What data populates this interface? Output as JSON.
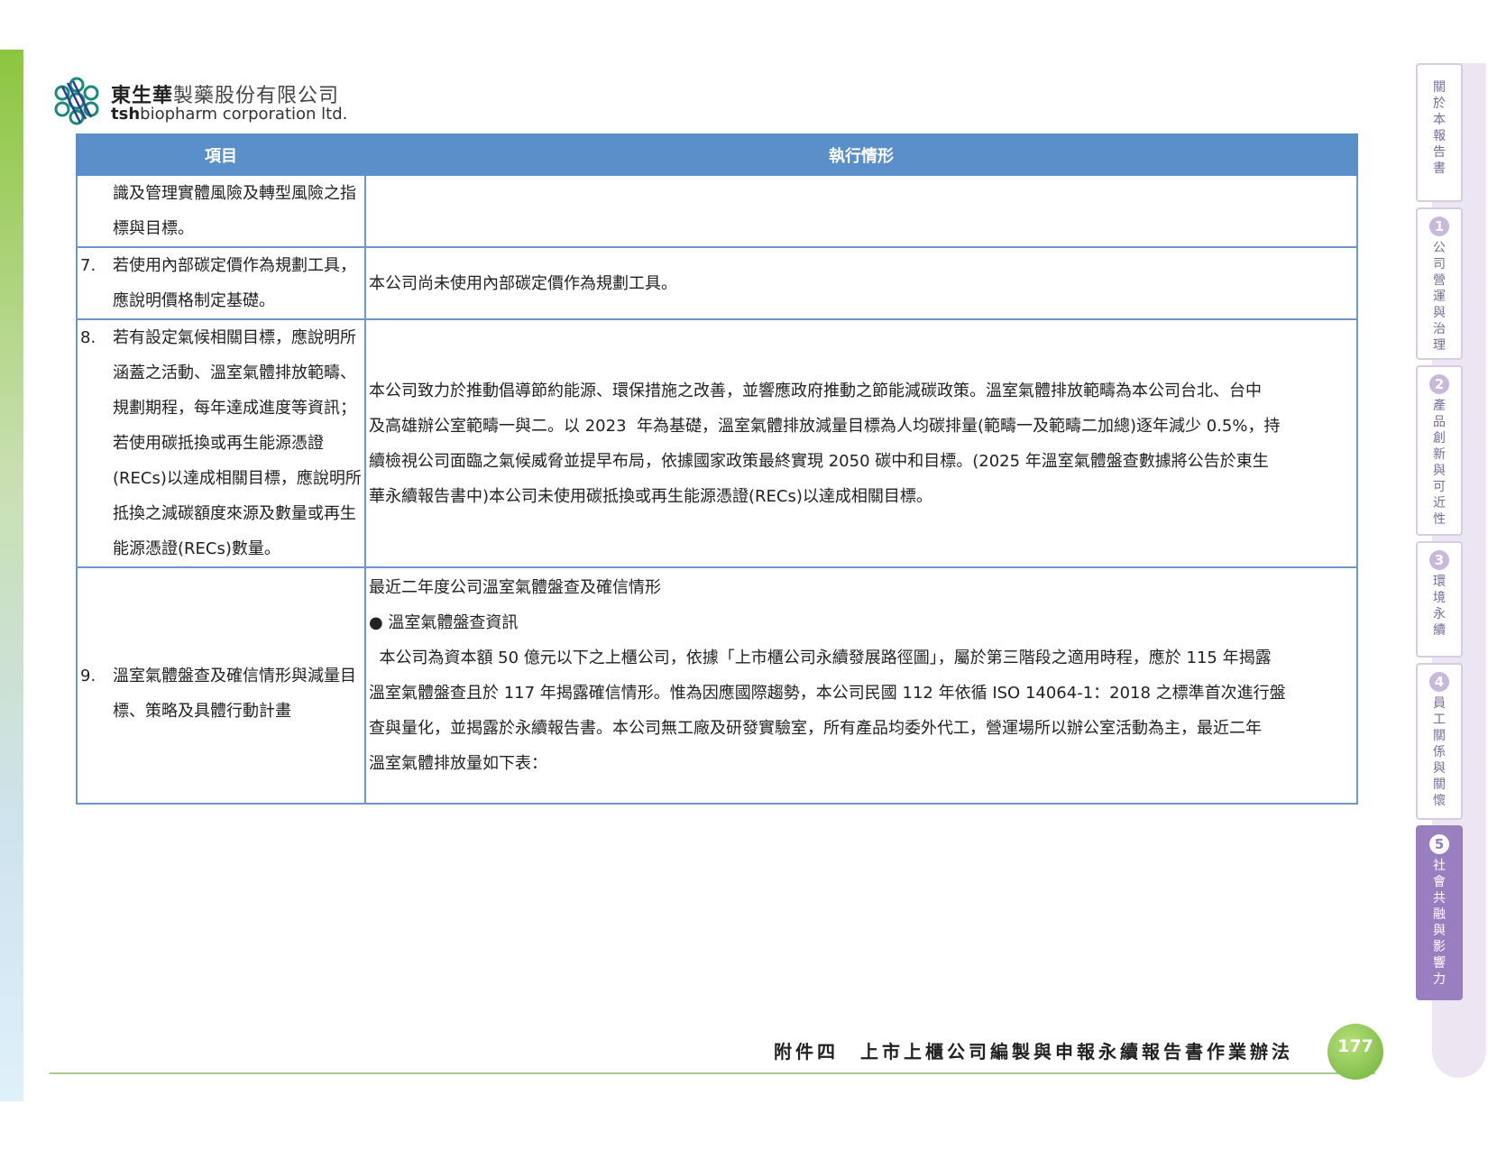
{
  "company": {
    "name_bold": "東生華",
    "name_rest": "製藥股份有限公司",
    "en_bold": "tsh",
    "en_rest": "biopharm corporation ltd."
  },
  "table": {
    "headers": [
      "項目",
      "執行情形"
    ],
    "rows": [
      {
        "num": "",
        "item_lines": [
          "識及管理實體風險及轉型風險之指",
          "標與目標。"
        ],
        "exec_lines": []
      },
      {
        "num": "7.",
        "item_lines": [
          "若使用內部碳定價作為規劃工具，",
          "應說明價格制定基礎。"
        ],
        "exec_lines": [
          "本公司尚未使用內部碳定價作為規劃工具。"
        ]
      },
      {
        "num": "8.",
        "item_lines": [
          "若有設定氣候相關目標，應說明所",
          "涵蓋之活動、溫室氣體排放範疇、",
          "規劃期程，每年達成進度等資訊；",
          "若使用碳抵換或再生能源憑證",
          "(RECs)以達成相關目標，應說明所",
          "抵換之減碳額度來源及數量或再生",
          "能源憑證(RECs)數量。"
        ],
        "exec_lines": [
          "本公司致力於推動倡導節約能源、環保措施之改善，並響應政府推動之節能減碳政策。溫室氣體排放範疇為本公司台北、台中",
          "及高雄辦公室範疇一與二。以 2023  年為基礎，溫室氣體排放減量目標為人均碳排量(範疇一及範疇二加總)逐年減少 0.5%，持",
          "續檢視公司面臨之氣候威脅並提早布局，依據國家政策最終實現 2050 碳中和目標。(2025 年溫室氣體盤查數據將公告於東生",
          "華永續報告書中)本公司未使用碳抵換或再生能源憑證(RECs)以達成相關目標。"
        ]
      },
      {
        "num": "9.",
        "item_lines": [
          "溫室氣體盤查及確信情形與減量目",
          "標、策略及具體行動計畫"
        ],
        "exec_lines": [
          "最近二年度公司溫室氣體盤查及確信情形",
          "● 溫室氣體盤查資訊",
          "  本公司為資本額 50 億元以下之上櫃公司，依據「上市櫃公司永續發展路徑圖」，屬於第三階段之適用時程，應於 115 年揭露",
          "溫室氣體盤查且於 117 年揭露確信情形。惟為因應國際趨勢，本公司民國 112 年依循 ISO 14064-1：2018 之標準首次進行盤",
          "查與量化，並揭露於永續報告書。本公司無工廠及研發實驗室，所有產品均委外代工，營運場所以辦公室活動為主，最近二年",
          "溫室氣體排放量如下表："
        ]
      }
    ]
  },
  "sidenav": [
    {
      "num": "",
      "label": "關於本報告書",
      "active": false
    },
    {
      "num": "1",
      "label": "公司營運與治理",
      "active": false
    },
    {
      "num": "2",
      "label": "產品創新與可近性",
      "active": false
    },
    {
      "num": "3",
      "label": "環境永續",
      "active": false
    },
    {
      "num": "4",
      "label": "員工關係與關懷",
      "active": false
    },
    {
      "num": "5",
      "label": "社會共融與影響力",
      "active": true
    }
  ],
  "footer": {
    "title": "附件四　上市上櫃公司編製與申報永續報告書作業辦法",
    "page": "177"
  }
}
